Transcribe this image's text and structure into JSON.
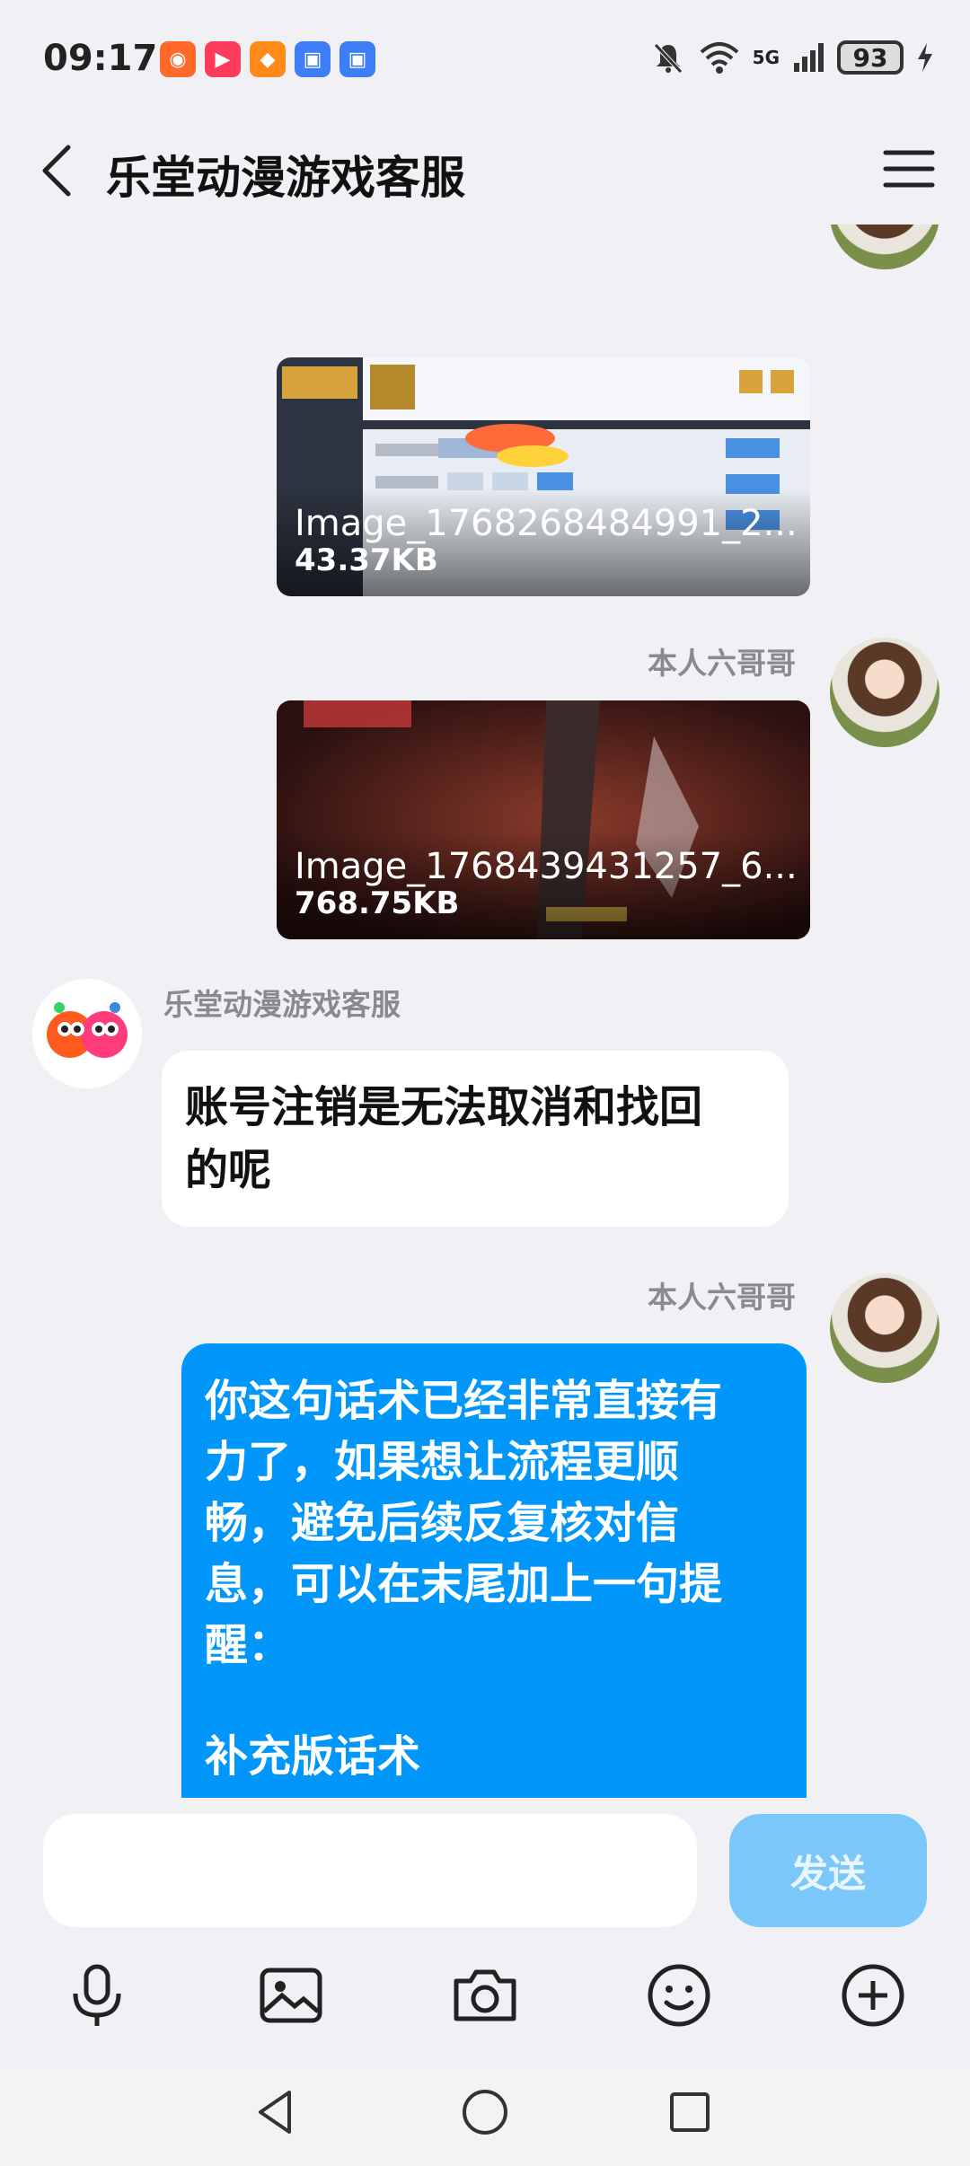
{
  "status_bar": {
    "time": "09:17",
    "network": "5G",
    "battery": "93",
    "app_icons": [
      {
        "name": "video-app-icon",
        "glyph": "◉",
        "color": "#ff6a2a"
      },
      {
        "name": "play-app-icon",
        "glyph": "▶",
        "color": "#ff3b5c"
      },
      {
        "name": "shop-app-icon",
        "glyph": "◆",
        "color": "#ff8a1a"
      },
      {
        "name": "security-app-icon",
        "glyph": "▣",
        "color": "#3d7df5"
      },
      {
        "name": "security-app-icon-2",
        "glyph": "▣",
        "color": "#3d7df5"
      }
    ]
  },
  "header": {
    "title": "乐堂动漫游戏客服"
  },
  "messages": [
    {
      "sender": "",
      "file_name": "Image_1768268484991_2...",
      "file_size": "43.37KB"
    },
    {
      "sender": "本人六哥哥",
      "file_name": "Image_1768439431257_6...",
      "file_size": "768.75KB"
    },
    {
      "sender": "乐堂动漫游戏客服",
      "text_lines": [
        "账号注销是无法取消和找回",
        "的呢"
      ]
    },
    {
      "sender": "本人六哥哥",
      "text_lines": [
        "你这句话术已经非常直接有",
        "力了，如果想让流程更顺",
        "畅，避免后续反复核对信",
        "息，可以在末尾加上一句提",
        "醒：",
        "",
        "补充版话术"
      ]
    }
  ],
  "input": {
    "placeholder": "",
    "send_label": "发送"
  },
  "colors": {
    "accent": "#0096fa",
    "send_disabled": "#7cc7fa",
    "background": "#f0f0f5"
  }
}
